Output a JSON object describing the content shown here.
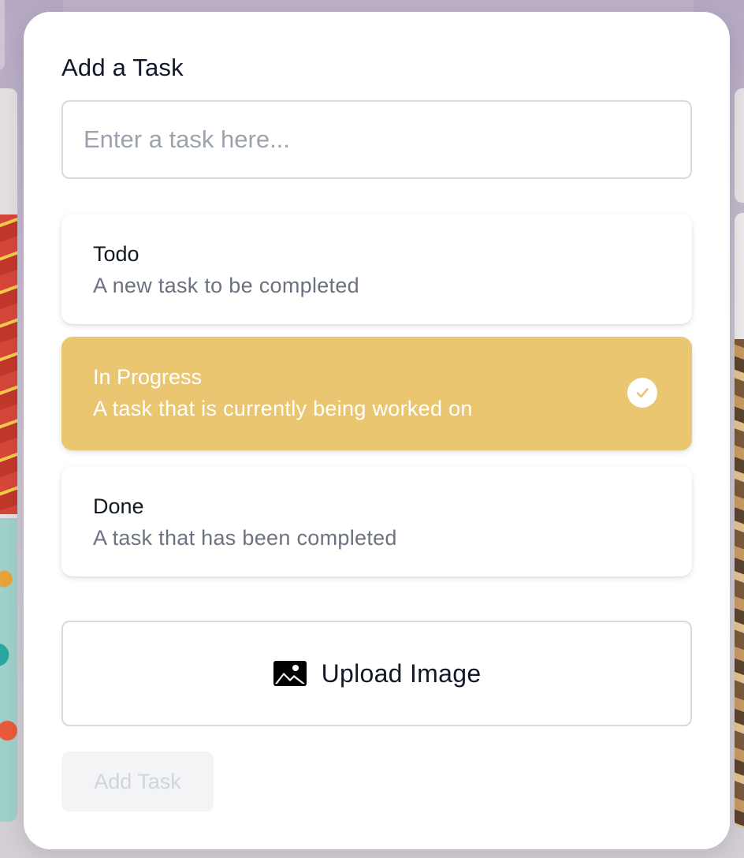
{
  "modal": {
    "title": "Add a Task",
    "task_input": {
      "value": "",
      "placeholder": "Enter a task here..."
    },
    "status_options": [
      {
        "title": "Todo",
        "description": "A new task to be completed",
        "selected": false
      },
      {
        "title": "In Progress",
        "description": "A task that is currently being worked on",
        "selected": true
      },
      {
        "title": "Done",
        "description": "A task that has been completed",
        "selected": false
      }
    ],
    "upload": {
      "label": "Upload Image",
      "icon": "image-icon"
    },
    "submit": {
      "label": "Add Task",
      "disabled": true
    }
  },
  "colors": {
    "selected_option": "#e9c66f",
    "text_primary": "#111827",
    "text_secondary": "#6b7280",
    "disabled_bg": "#f3f4f6",
    "disabled_text": "#d1d5db"
  },
  "icons": {
    "check": "check-circle-icon",
    "upload": "image-icon"
  }
}
